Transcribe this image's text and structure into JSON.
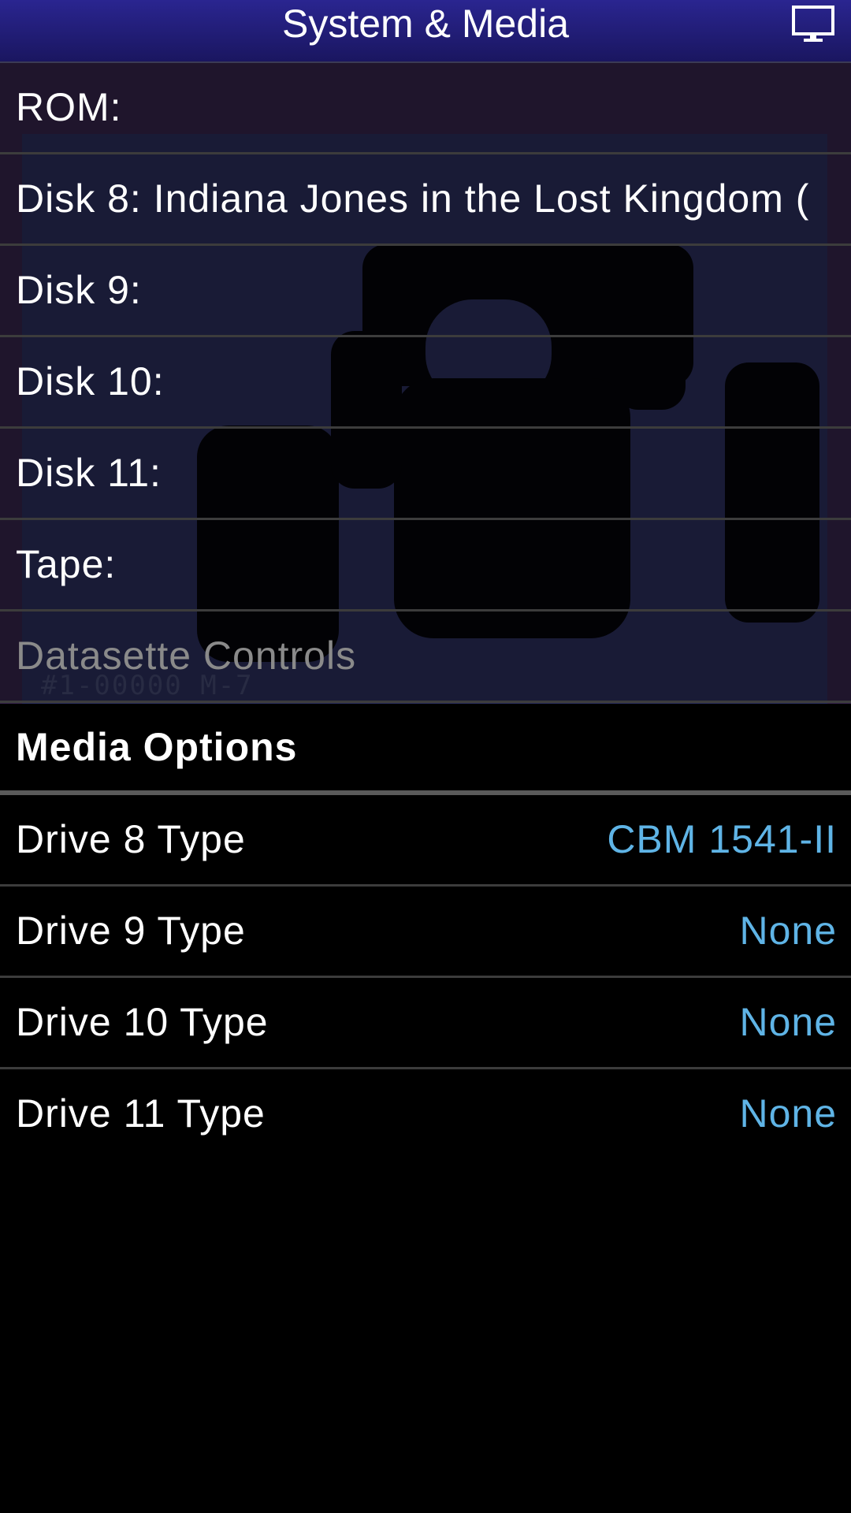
{
  "header": {
    "title": "System & Media",
    "monitor_icon": "monitor-icon"
  },
  "media_items": [
    {
      "label": "ROM:",
      "enabled": true
    },
    {
      "label": "Disk 8: Indiana Jones in the Lost Kingdom (",
      "enabled": true
    },
    {
      "label": "Disk 9:",
      "enabled": true
    },
    {
      "label": "Disk 10:",
      "enabled": true
    },
    {
      "label": "Disk 11:",
      "enabled": true
    },
    {
      "label": "Tape:",
      "enabled": true
    },
    {
      "label": "Datasette Controls",
      "enabled": false
    }
  ],
  "background_status": "#1-00000  M-7",
  "media_options": {
    "title": "Media Options",
    "drives": [
      {
        "label": "Drive 8 Type",
        "value": "CBM 1541-II"
      },
      {
        "label": "Drive 9 Type",
        "value": "None"
      },
      {
        "label": "Drive 10 Type",
        "value": "None"
      },
      {
        "label": "Drive 11 Type",
        "value": "None"
      }
    ]
  },
  "colors": {
    "header_bg": "#2a2590",
    "value_accent": "#5fb4e6",
    "disabled_text": "#8a8a8a"
  }
}
